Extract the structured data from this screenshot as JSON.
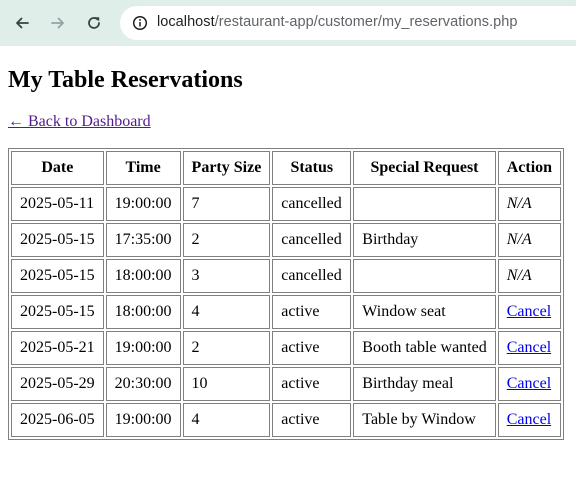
{
  "browser": {
    "url_host": "localhost",
    "url_path": "/restaurant-app/customer/my_reservations.php"
  },
  "page": {
    "title": "My Table Reservations",
    "back_link": "← Back to Dashboard"
  },
  "table": {
    "headers": [
      "Date",
      "Time",
      "Party Size",
      "Status",
      "Special Request",
      "Action"
    ],
    "rows": [
      {
        "date": "2025-05-11",
        "time": "19:00:00",
        "party": "7",
        "status": "cancelled",
        "request": "",
        "action": "N/A"
      },
      {
        "date": "2025-05-15",
        "time": "17:35:00",
        "party": "2",
        "status": "cancelled",
        "request": "Birthday",
        "action": "N/A"
      },
      {
        "date": "2025-05-15",
        "time": "18:00:00",
        "party": "3",
        "status": "cancelled",
        "request": "",
        "action": "N/A"
      },
      {
        "date": "2025-05-15",
        "time": "18:00:00",
        "party": "4",
        "status": "active",
        "request": "Window seat",
        "action": "Cancel"
      },
      {
        "date": "2025-05-21",
        "time": "19:00:00",
        "party": "2",
        "status": "active",
        "request": "Booth table wanted",
        "action": "Cancel"
      },
      {
        "date": "2025-05-29",
        "time": "20:30:00",
        "party": "10",
        "status": "active",
        "request": "Birthday meal",
        "action": "Cancel"
      },
      {
        "date": "2025-06-05",
        "time": "19:00:00",
        "party": "4",
        "status": "active",
        "request": "Table by Window",
        "action": "Cancel"
      }
    ]
  },
  "icons": {
    "back": "arrow-left-icon",
    "forward": "arrow-right-icon",
    "reload": "reload-icon",
    "site_info": "site-info-icon"
  },
  "colors": {
    "toolbar_bg": "#dfeee9",
    "visited_link": "#551a8b",
    "link": "#0000ee",
    "table_border": "#808080"
  }
}
